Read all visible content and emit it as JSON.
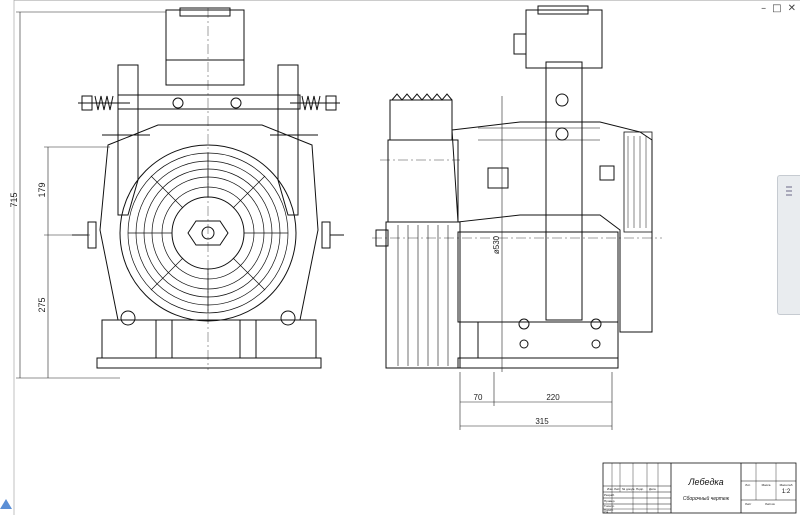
{
  "window": {
    "minimize": "–",
    "restore": "□",
    "close": "✕"
  },
  "dimensions": {
    "overall_height": "715",
    "upper_height": "179",
    "lower_height": "275",
    "diameter": "ø530",
    "width_70": "70",
    "width_220": "220",
    "width_315": "315"
  },
  "title_block": {
    "name": "Лебедка",
    "subtitle": "Сборочный чертеж",
    "scale": "1:2",
    "col_labels": [
      "Лит.",
      "Масса",
      "Масштаб"
    ],
    "row_labels": [
      "Изм.",
      "Лист",
      "№ докум.",
      "Подп.",
      "Дата"
    ],
    "left_labels": [
      "Разраб.",
      "Провер.",
      "Т.контр.",
      "Н.контр.",
      "Утв."
    ],
    "sheet_labels": [
      "Лист",
      "Листов"
    ]
  },
  "colors": {
    "line": "#111111",
    "dim": "#222222",
    "nav": "#e9ecef"
  },
  "icons": {
    "nav_handle": "grip-icon",
    "corner": "triangle-icon"
  }
}
